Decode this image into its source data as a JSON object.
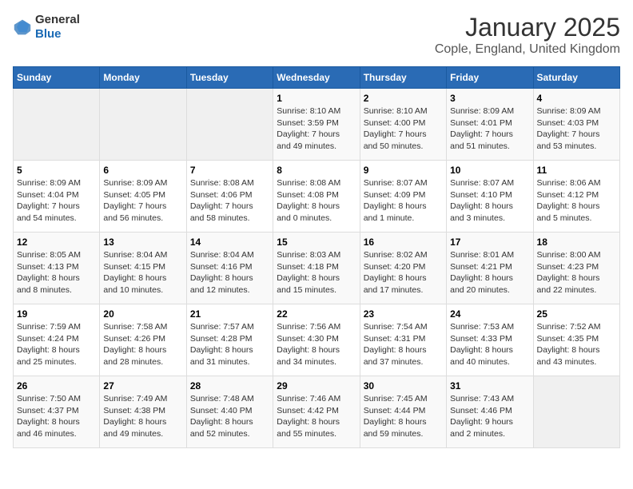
{
  "header": {
    "logo_general": "General",
    "logo_blue": "Blue",
    "main_title": "January 2025",
    "subtitle": "Cople, England, United Kingdom"
  },
  "days_of_week": [
    "Sunday",
    "Monday",
    "Tuesday",
    "Wednesday",
    "Thursday",
    "Friday",
    "Saturday"
  ],
  "weeks": [
    {
      "days": [
        {
          "number": "",
          "info": ""
        },
        {
          "number": "",
          "info": ""
        },
        {
          "number": "",
          "info": ""
        },
        {
          "number": "1",
          "info": "Sunrise: 8:10 AM\nSunset: 3:59 PM\nDaylight: 7 hours\nand 49 minutes."
        },
        {
          "number": "2",
          "info": "Sunrise: 8:10 AM\nSunset: 4:00 PM\nDaylight: 7 hours\nand 50 minutes."
        },
        {
          "number": "3",
          "info": "Sunrise: 8:09 AM\nSunset: 4:01 PM\nDaylight: 7 hours\nand 51 minutes."
        },
        {
          "number": "4",
          "info": "Sunrise: 8:09 AM\nSunset: 4:03 PM\nDaylight: 7 hours\nand 53 minutes."
        }
      ]
    },
    {
      "days": [
        {
          "number": "5",
          "info": "Sunrise: 8:09 AM\nSunset: 4:04 PM\nDaylight: 7 hours\nand 54 minutes."
        },
        {
          "number": "6",
          "info": "Sunrise: 8:09 AM\nSunset: 4:05 PM\nDaylight: 7 hours\nand 56 minutes."
        },
        {
          "number": "7",
          "info": "Sunrise: 8:08 AM\nSunset: 4:06 PM\nDaylight: 7 hours\nand 58 minutes."
        },
        {
          "number": "8",
          "info": "Sunrise: 8:08 AM\nSunset: 4:08 PM\nDaylight: 8 hours\nand 0 minutes."
        },
        {
          "number": "9",
          "info": "Sunrise: 8:07 AM\nSunset: 4:09 PM\nDaylight: 8 hours\nand 1 minute."
        },
        {
          "number": "10",
          "info": "Sunrise: 8:07 AM\nSunset: 4:10 PM\nDaylight: 8 hours\nand 3 minutes."
        },
        {
          "number": "11",
          "info": "Sunrise: 8:06 AM\nSunset: 4:12 PM\nDaylight: 8 hours\nand 5 minutes."
        }
      ]
    },
    {
      "days": [
        {
          "number": "12",
          "info": "Sunrise: 8:05 AM\nSunset: 4:13 PM\nDaylight: 8 hours\nand 8 minutes."
        },
        {
          "number": "13",
          "info": "Sunrise: 8:04 AM\nSunset: 4:15 PM\nDaylight: 8 hours\nand 10 minutes."
        },
        {
          "number": "14",
          "info": "Sunrise: 8:04 AM\nSunset: 4:16 PM\nDaylight: 8 hours\nand 12 minutes."
        },
        {
          "number": "15",
          "info": "Sunrise: 8:03 AM\nSunset: 4:18 PM\nDaylight: 8 hours\nand 15 minutes."
        },
        {
          "number": "16",
          "info": "Sunrise: 8:02 AM\nSunset: 4:20 PM\nDaylight: 8 hours\nand 17 minutes."
        },
        {
          "number": "17",
          "info": "Sunrise: 8:01 AM\nSunset: 4:21 PM\nDaylight: 8 hours\nand 20 minutes."
        },
        {
          "number": "18",
          "info": "Sunrise: 8:00 AM\nSunset: 4:23 PM\nDaylight: 8 hours\nand 22 minutes."
        }
      ]
    },
    {
      "days": [
        {
          "number": "19",
          "info": "Sunrise: 7:59 AM\nSunset: 4:24 PM\nDaylight: 8 hours\nand 25 minutes."
        },
        {
          "number": "20",
          "info": "Sunrise: 7:58 AM\nSunset: 4:26 PM\nDaylight: 8 hours\nand 28 minutes."
        },
        {
          "number": "21",
          "info": "Sunrise: 7:57 AM\nSunset: 4:28 PM\nDaylight: 8 hours\nand 31 minutes."
        },
        {
          "number": "22",
          "info": "Sunrise: 7:56 AM\nSunset: 4:30 PM\nDaylight: 8 hours\nand 34 minutes."
        },
        {
          "number": "23",
          "info": "Sunrise: 7:54 AM\nSunset: 4:31 PM\nDaylight: 8 hours\nand 37 minutes."
        },
        {
          "number": "24",
          "info": "Sunrise: 7:53 AM\nSunset: 4:33 PM\nDaylight: 8 hours\nand 40 minutes."
        },
        {
          "number": "25",
          "info": "Sunrise: 7:52 AM\nSunset: 4:35 PM\nDaylight: 8 hours\nand 43 minutes."
        }
      ]
    },
    {
      "days": [
        {
          "number": "26",
          "info": "Sunrise: 7:50 AM\nSunset: 4:37 PM\nDaylight: 8 hours\nand 46 minutes."
        },
        {
          "number": "27",
          "info": "Sunrise: 7:49 AM\nSunset: 4:38 PM\nDaylight: 8 hours\nand 49 minutes."
        },
        {
          "number": "28",
          "info": "Sunrise: 7:48 AM\nSunset: 4:40 PM\nDaylight: 8 hours\nand 52 minutes."
        },
        {
          "number": "29",
          "info": "Sunrise: 7:46 AM\nSunset: 4:42 PM\nDaylight: 8 hours\nand 55 minutes."
        },
        {
          "number": "30",
          "info": "Sunrise: 7:45 AM\nSunset: 4:44 PM\nDaylight: 8 hours\nand 59 minutes."
        },
        {
          "number": "31",
          "info": "Sunrise: 7:43 AM\nSunset: 4:46 PM\nDaylight: 9 hours\nand 2 minutes."
        },
        {
          "number": "",
          "info": ""
        }
      ]
    }
  ]
}
